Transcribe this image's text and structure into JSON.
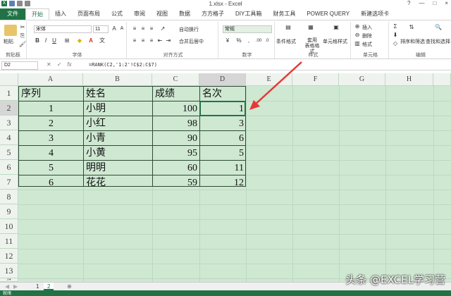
{
  "window": {
    "title": "1.xlsx - Excel",
    "controls": [
      "?",
      "—",
      "□",
      "×"
    ]
  },
  "tabs": [
    "文件",
    "开始",
    "插入",
    "页面布局",
    "公式",
    "审阅",
    "视图",
    "数据",
    "方方格子",
    "DIY工具箱",
    "财务工具",
    "POWER QUERY",
    "新建选项卡"
  ],
  "ribbon": {
    "clipboard": {
      "paste": "粘贴",
      "label": "剪贴板"
    },
    "font": {
      "name": "宋体",
      "size": "11",
      "label": "字体",
      "bold": "B",
      "italic": "I",
      "underline": "U"
    },
    "alignment": {
      "wrap": "自动换行",
      "merge": "合并后居中",
      "label": "对齐方式"
    },
    "number": {
      "format": "常规",
      "label": "数字"
    },
    "styles": {
      "conditional": "条件格式",
      "table_format": "套用\n表格格式",
      "cell_styles": "单元格样式",
      "label": "样式"
    },
    "cells": {
      "insert": "插入",
      "delete": "删除",
      "format": "格式",
      "label": "单元格"
    },
    "editing": {
      "sort": "排序和筛选",
      "find": "查找和选择",
      "label": "编辑"
    }
  },
  "formula_bar": {
    "name_box": "D2",
    "formula": "=RANK(C2,'1:2'!C$2:C$7)"
  },
  "columns": [
    "A",
    "B",
    "C",
    "D",
    "E",
    "F",
    "G",
    "H"
  ],
  "rows": [
    "1",
    "2",
    "3",
    "4",
    "5",
    "6",
    "7",
    "8",
    "9",
    "10",
    "11",
    "12",
    "13",
    "14"
  ],
  "table": {
    "headers": [
      "序列",
      "姓名",
      "成绩",
      "名次"
    ],
    "rows": [
      [
        "1",
        "小明",
        "100",
        "1"
      ],
      [
        "2",
        "小红",
        "98",
        "3"
      ],
      [
        "3",
        "小青",
        "90",
        "6"
      ],
      [
        "4",
        "小黄",
        "95",
        "5"
      ],
      [
        "5",
        "明明",
        "60",
        "11"
      ],
      [
        "6",
        "花花",
        "59",
        "12"
      ]
    ]
  },
  "sheets": [
    "1",
    "2"
  ],
  "active_sheet": "2",
  "status": "就绪",
  "watermark": "头条 @EXCEL学习营",
  "colors": {
    "accent": "#217346",
    "grid_bg": "#cfe8d2",
    "arrow": "#e53935"
  }
}
